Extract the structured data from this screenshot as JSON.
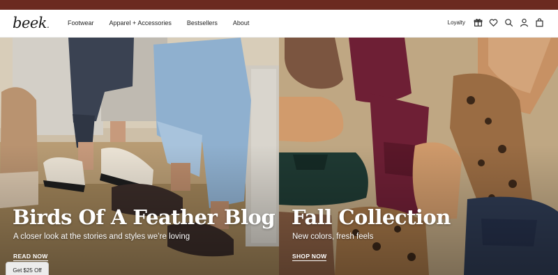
{
  "brand": {
    "logo_text": "beek",
    "logo_dot": "."
  },
  "nav": {
    "links": [
      "Footwear",
      "Apparel + Accessories",
      "Bestsellers",
      "About"
    ],
    "loyalty_label": "Loyalty",
    "icons": [
      "gift-icon",
      "heart-icon",
      "search-icon",
      "user-icon",
      "bag-icon"
    ]
  },
  "colors": {
    "promo_bar": "#6b2a20",
    "text_dark": "#222222",
    "hero_text": "#ffffff"
  },
  "hero_left": {
    "title": "Birds Of A Feather Blog",
    "subtitle": "A closer look at the stories and styles we’re loving",
    "cta": "READ NOW"
  },
  "hero_right": {
    "title": "Fall Collection",
    "subtitle": "New colors, fresh feels",
    "cta": "SHOP NOW"
  },
  "discount_tab": {
    "label": "Get $25 Off"
  }
}
